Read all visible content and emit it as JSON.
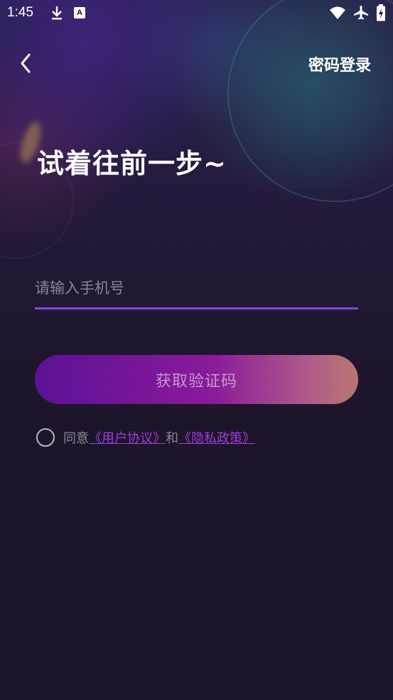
{
  "status_bar": {
    "time": "1:45",
    "letter_icon": "A"
  },
  "header": {
    "password_login": "密码登录"
  },
  "headline": "试着往前一步~",
  "phone_input": {
    "placeholder": "请输入手机号",
    "value": ""
  },
  "get_code_button": "获取验证码",
  "agreement": {
    "prefix": "同意",
    "user_agreement": "《用户协议》",
    "and": "和",
    "privacy_policy": "《隐私政策》"
  },
  "colors": {
    "accent": "#8b46d9",
    "link": "#a13bdb",
    "background": "#1c1428"
  }
}
